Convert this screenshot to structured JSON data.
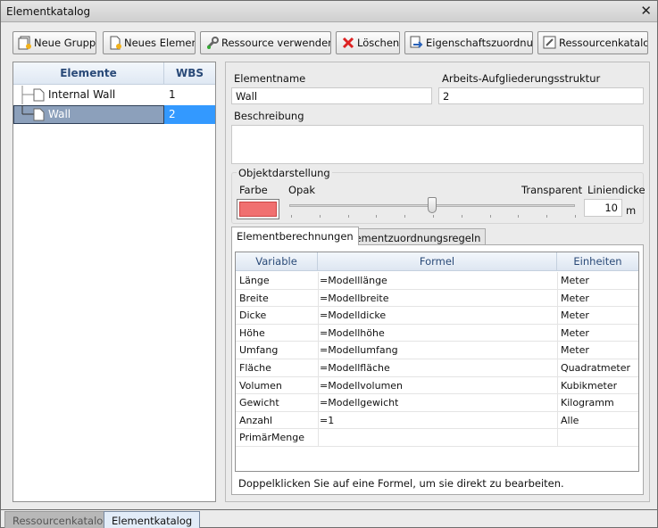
{
  "window": {
    "title": "Elementkatalog"
  },
  "toolbar": {
    "new_group": "Neue Gruppe",
    "new_element": "Neues Element",
    "use_resource": "Ressource verwenden",
    "delete": "Löschen",
    "property_mapping": "Eigenschaftszuordnung",
    "resource_catalog": "Ressourcenkatalog"
  },
  "tree": {
    "headers": {
      "name": "Elemente",
      "wbs": "WBS"
    },
    "items": [
      {
        "name": "Internal Wall",
        "wbs": "1"
      },
      {
        "name": "Wall",
        "wbs": "2"
      }
    ]
  },
  "form": {
    "element_name_label": "Elementname",
    "element_name": "Wall",
    "wbs_label": "Arbeits-Aufgliederungsstruktur",
    "wbs": "2",
    "description_label": "Beschreibung",
    "description": ""
  },
  "display": {
    "group_label": "Objektdarstellung",
    "color_label": "Farbe",
    "color": "#f07070",
    "opaque_label": "Opak",
    "transparent_label": "Transparent",
    "slider_value": 0.5,
    "line_thickness_label": "Liniendicke",
    "line_thickness": "10",
    "line_unit": "m"
  },
  "tabs": {
    "calc": "Elementberechnungen",
    "rules": "Elementzuordnungsregeln"
  },
  "grid": {
    "headers": {
      "variable": "Variable",
      "formula": "Formel",
      "unit": "Einheiten"
    },
    "rows": [
      {
        "variable": "Länge",
        "formula": "=Modelllänge",
        "unit": "Meter"
      },
      {
        "variable": "Breite",
        "formula": "=Modellbreite",
        "unit": "Meter"
      },
      {
        "variable": "Dicke",
        "formula": "=Modelldicke",
        "unit": "Meter"
      },
      {
        "variable": "Höhe",
        "formula": "=Modellhöhe",
        "unit": "Meter"
      },
      {
        "variable": "Umfang",
        "formula": "=Modellumfang",
        "unit": "Meter"
      },
      {
        "variable": "Fläche",
        "formula": "=Modellfläche",
        "unit": "Quadratmeter"
      },
      {
        "variable": "Volumen",
        "formula": "=Modellvolumen",
        "unit": "Kubikmeter"
      },
      {
        "variable": "Gewicht",
        "formula": "=Modellgewicht",
        "unit": "Kilogramm"
      },
      {
        "variable": "Anzahl",
        "formula": "=1",
        "unit": "Alle"
      },
      {
        "variable": "PrimärMenge",
        "formula": "",
        "unit": ""
      }
    ]
  },
  "hint": "Doppelklicken Sie auf eine Formel, um sie direkt zu bearbeiten.",
  "bottom_tabs": [
    "Ressourcenkatalog",
    "Elementkatalog"
  ]
}
